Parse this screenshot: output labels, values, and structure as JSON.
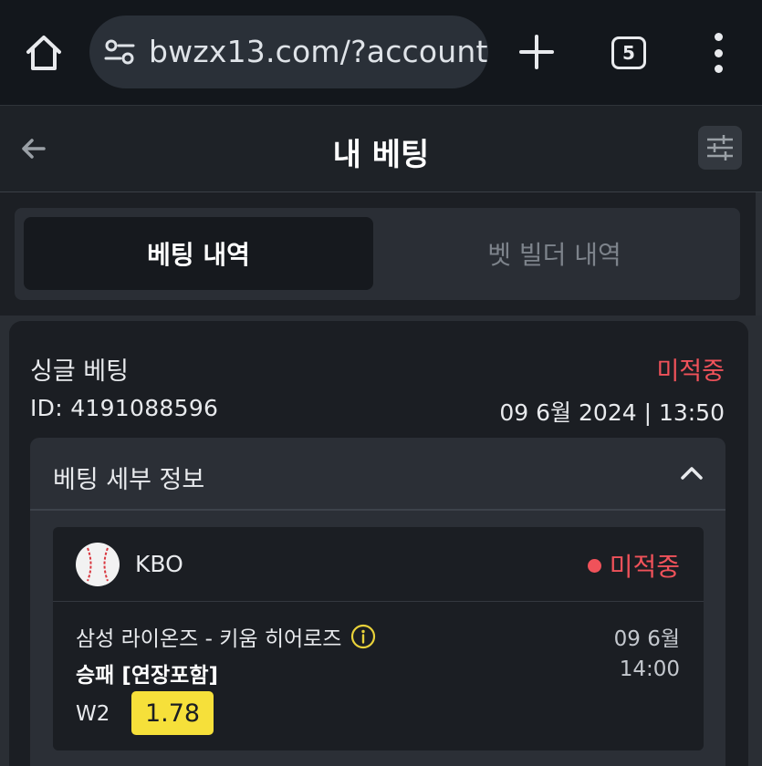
{
  "browser": {
    "url": "bwzx13.com/?account",
    "tab_count": "5",
    "icons": [
      "home-icon",
      "site-settings-icon",
      "plus-icon",
      "tabs-icon",
      "more-vert-icon"
    ]
  },
  "header": {
    "title": "내 베팅",
    "icons": [
      "back-arrow-icon",
      "filter-sliders-icon"
    ]
  },
  "tabs": [
    {
      "label": "베팅 내역",
      "active": true
    },
    {
      "label": "벳 빌더 내역",
      "active": false
    }
  ],
  "bet": {
    "type": "싱글 베팅",
    "status": "미적중",
    "id": "ID: 4191088596",
    "date": "09 6월 2024 | 13:50",
    "details_title": "베팅 세부 정보",
    "selection": {
      "league": "KBO",
      "status": "미적중",
      "match": "삼성 라이온즈 - 키움 히어로즈",
      "match_date": "09 6월",
      "market": "승패 [연장포함]",
      "match_time": "14:00",
      "outcome": "W2",
      "odds": "1.78"
    }
  },
  "colors": {
    "status_red": "#f0525a",
    "odds_yellow": "#f6e03a",
    "info_yellow": "#e9d23a",
    "background": "#1c1f24"
  }
}
